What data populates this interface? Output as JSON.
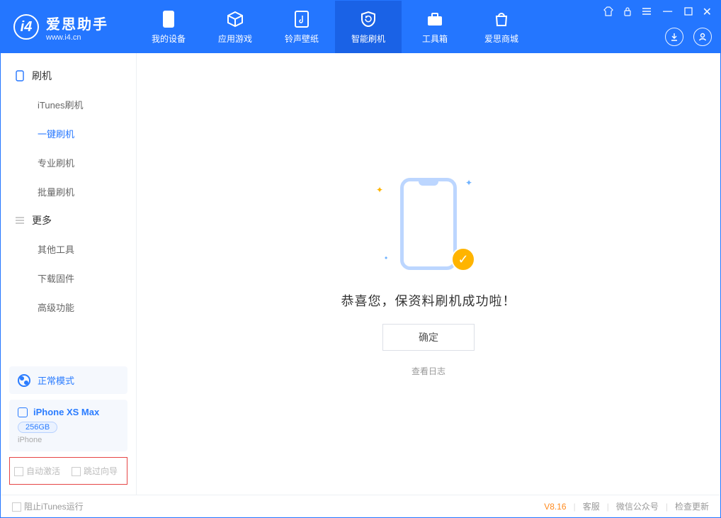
{
  "app": {
    "name_cn": "爱思助手",
    "url": "www.i4.cn"
  },
  "nav": {
    "items": [
      {
        "label": "我的设备"
      },
      {
        "label": "应用游戏"
      },
      {
        "label": "铃声壁纸"
      },
      {
        "label": "智能刷机"
      },
      {
        "label": "工具箱"
      },
      {
        "label": "爱思商城"
      }
    ],
    "active_index": 3
  },
  "sidebar": {
    "groups": [
      {
        "title": "刷机",
        "items": [
          "iTunes刷机",
          "一键刷机",
          "专业刷机",
          "批量刷机"
        ],
        "active_index": 1
      },
      {
        "title": "更多",
        "items": [
          "其他工具",
          "下载固件",
          "高级功能"
        ]
      }
    ],
    "mode": "正常模式",
    "device": {
      "name": "iPhone XS Max",
      "capacity": "256GB",
      "type": "iPhone"
    },
    "checks": {
      "auto_activate": "自动激活",
      "skip_guide": "跳过向导"
    }
  },
  "main": {
    "message": "恭喜您，保资料刷机成功啦！",
    "ok": "确定",
    "view_log": "查看日志"
  },
  "footer": {
    "block_itunes": "阻止iTunes运行",
    "version": "V8.16",
    "links": [
      "客服",
      "微信公众号",
      "检查更新"
    ]
  }
}
